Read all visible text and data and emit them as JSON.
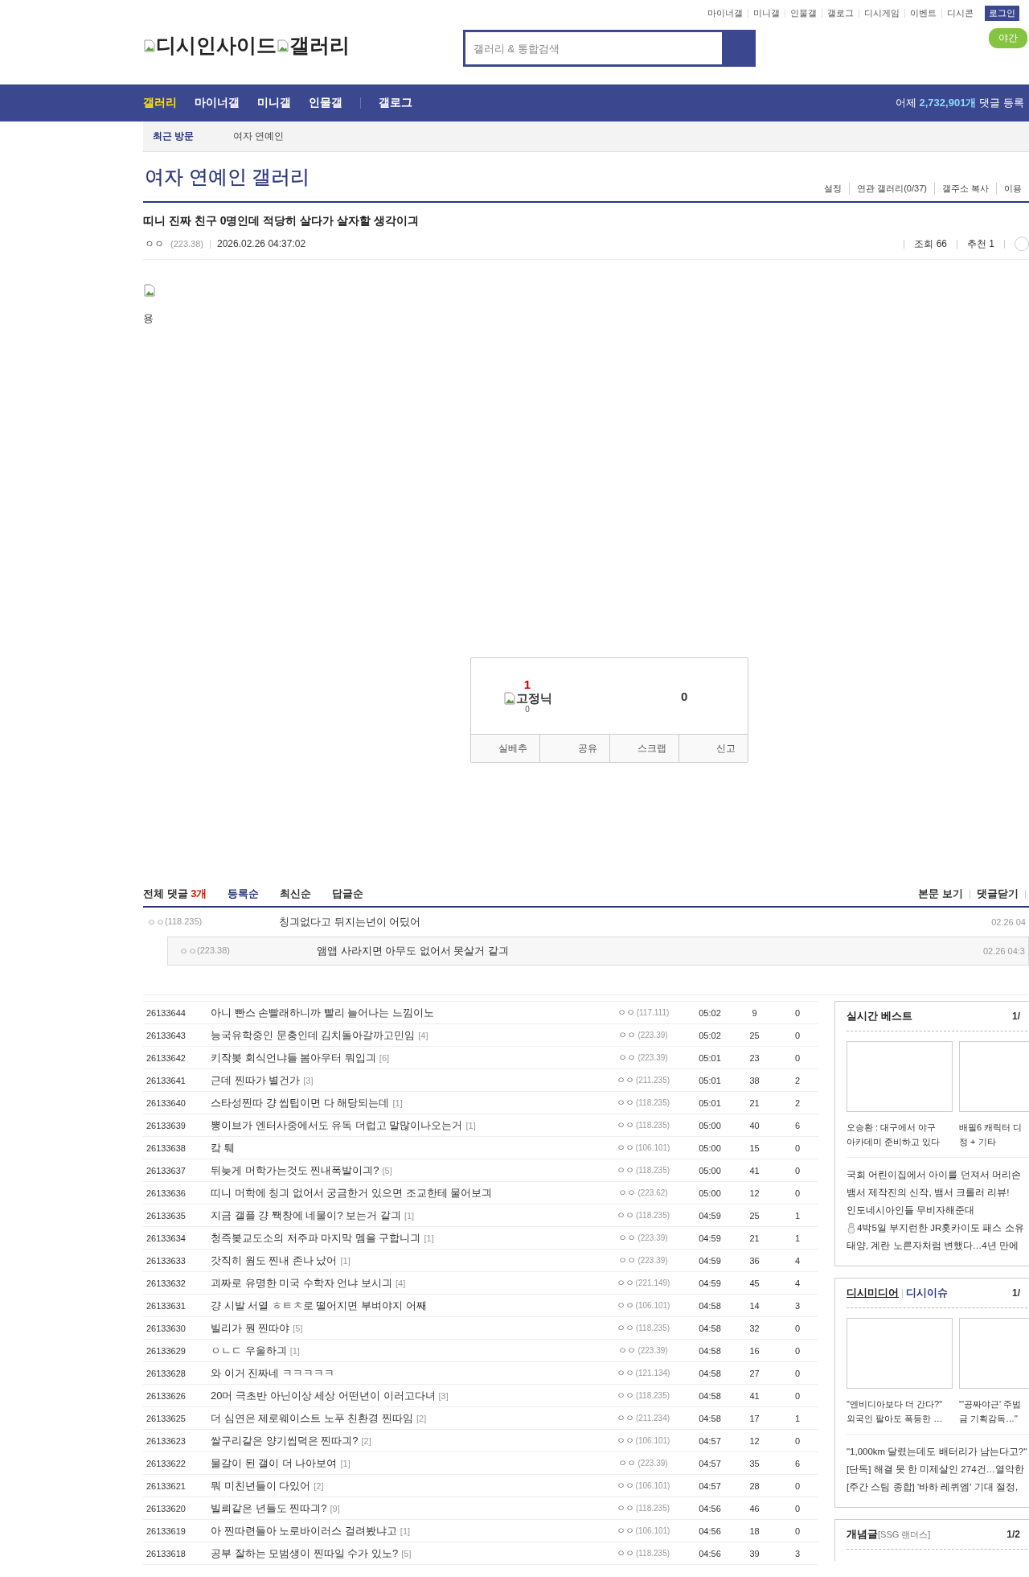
{
  "top_links": [
    "마이너갤",
    "미니갤",
    "인물갤",
    "갤로그",
    "디시게임",
    "이벤트",
    "디시콘"
  ],
  "login_button": "로그인",
  "night_mode_button": "야간",
  "logo": {
    "site": "디시인사이드",
    "section": "갤러리"
  },
  "search": {
    "placeholder": "갤러리 & 통합검색"
  },
  "nav": {
    "items": [
      {
        "label": "갤러리",
        "selected": true
      },
      {
        "label": "마이너갤",
        "selected": false
      },
      {
        "label": "미니갤",
        "selected": false
      },
      {
        "label": "인물갤",
        "selected": false
      },
      {
        "label": "갤로그",
        "selected": false
      }
    ],
    "stat_prefix": "어제",
    "stat_number": "2,732,901개",
    "stat_suffix": "댓글 등록"
  },
  "recent": {
    "label": "최근 방문",
    "items": [
      "여자 연예인"
    ]
  },
  "gallery": {
    "title": "여자 연예인 갤러리",
    "links": [
      "설정",
      "연관 갤러리(0/37)",
      "갤주소 복사",
      "이용"
    ]
  },
  "post": {
    "title": "띠니 진짜 친구 0명인데 적당히 살다가 살자할 생각이긔",
    "nick": "ㅇㅇ",
    "ip": "(223.38)",
    "date": "2026.02.26 04:37:02",
    "views": "조회 66",
    "recommend": "추천 1",
    "body_text": "용"
  },
  "vote": {
    "up": "1",
    "fixnick_label": "고정닉",
    "fixnick_count": "0",
    "down": "0",
    "buttons": [
      "실베추",
      "공유",
      "스크랩",
      "신고"
    ]
  },
  "comments": {
    "title": "전체 댓글",
    "count": "3개",
    "sorts": [
      {
        "label": "등록순",
        "selected": true
      },
      {
        "label": "최신순",
        "selected": false
      },
      {
        "label": "답글순",
        "selected": false
      }
    ],
    "actions": [
      "본문 보기",
      "댓글닫기"
    ],
    "items": [
      {
        "nick": "ㅇㅇ",
        "ip": "(118.235)",
        "text": "칭긔없다고 뒤지는년이 어딨어",
        "date": "02.26 04",
        "children": [
          {
            "nick": "ㅇㅇ",
            "ip": "(223.38)",
            "text": "앰앱 사라지면 아무도 없어서 못살거 같긔",
            "date": "02.26 04:3"
          }
        ]
      }
    ]
  },
  "list": [
    {
      "no": "26133644",
      "title": "아니 빤스 손빨래하니까 빨리 늘어나는 느낌이노",
      "nick": "ㅇㅇ",
      "ip": "(117.111)",
      "time": "05:02",
      "views": "9",
      "recommend": "0"
    },
    {
      "no": "26133643",
      "title": "능국유학중인 문충인데 김치돌아갈까고민임",
      "replies": "[4]",
      "nick": "ㅇㅇ",
      "ip": "(223.39)",
      "time": "05:02",
      "views": "25",
      "recommend": "0"
    },
    {
      "no": "26133642",
      "title": "키작봊 회식언냐들 봄아우터 뭐입긔",
      "replies": "[6]",
      "nick": "ㅇㅇ",
      "ip": "(223.39)",
      "time": "05:01",
      "views": "23",
      "recommend": "0"
    },
    {
      "no": "26133641",
      "title": "근데 찐따가 별건가",
      "replies": "[3]",
      "nick": "ㅇㅇ",
      "ip": "(211.235)",
      "time": "05:01",
      "views": "38",
      "recommend": "2"
    },
    {
      "no": "26133640",
      "title": "스타성찐따 걍 씹팁이면 다 해당되는데",
      "replies": "[1]",
      "nick": "ㅇㅇ",
      "ip": "(118.235)",
      "time": "05:01",
      "views": "21",
      "recommend": "2"
    },
    {
      "no": "26133639",
      "title": "뽕이브가 엔터사중에서도 유독 더럽고 말많이나오는거",
      "replies": "[1]",
      "nick": "ㅇㅇ",
      "ip": "(118.235)",
      "time": "05:00",
      "views": "40",
      "recommend": "6"
    },
    {
      "no": "26133638",
      "title": "캌 퉤",
      "nick": "ㅇㅇ",
      "ip": "(106.101)",
      "time": "05:00",
      "views": "15",
      "recommend": "0"
    },
    {
      "no": "26133637",
      "title": "뒤늦게 머학가는것도 찐내폭발이긔?",
      "replies": "[5]",
      "nick": "ㅇㅇ",
      "ip": "(118.235)",
      "time": "05:00",
      "views": "41",
      "recommend": "0"
    },
    {
      "no": "26133636",
      "title": "띠니 머학에 칭긔 없어서 궁금한거 있으면 조교한테 물어보긔",
      "nick": "ㅇㅇ",
      "ip": "(223.62)",
      "time": "05:00",
      "views": "12",
      "recommend": "0"
    },
    {
      "no": "26133635",
      "title": "지금 갤플 걍 짹창에 네물이? 보는거 같긔",
      "replies": "[1]",
      "nick": "ㅇㅇ",
      "ip": "(118.235)",
      "time": "04:59",
      "views": "25",
      "recommend": "1"
    },
    {
      "no": "26133634",
      "title": "청즉봊교도소의 저주파 마지막 멤을 구합니긔",
      "replies": "[1]",
      "nick": "ㅇㅇ",
      "ip": "(223.39)",
      "time": "04:59",
      "views": "21",
      "recommend": "1"
    },
    {
      "no": "26133633",
      "title": "갓직히 웜도 찐내 존나 났어",
      "replies": "[1]",
      "nick": "ㅇㅇ",
      "ip": "(223.39)",
      "time": "04:59",
      "views": "36",
      "recommend": "4"
    },
    {
      "no": "26133632",
      "title": "괴짜로 유명한 미국 수학자 언냐 보시긔",
      "replies": "[4]",
      "nick": "ㅇㅇ",
      "ip": "(221.149)",
      "time": "04:59",
      "views": "45",
      "recommend": "4"
    },
    {
      "no": "26133631",
      "title": "걍 시발 서열 ㅎㅌㅊ로 떨어지면 부벼야지 어째",
      "nick": "ㅇㅇ",
      "ip": "(106.101)",
      "time": "04:58",
      "views": "14",
      "recommend": "3"
    },
    {
      "no": "26133630",
      "title": "빌리가 뭔 찐따야",
      "replies": "[5]",
      "nick": "ㅇㅇ",
      "ip": "(118.235)",
      "time": "04:58",
      "views": "32",
      "recommend": "0"
    },
    {
      "no": "26133629",
      "title": "ㅇㄴㄷ 우울하긔",
      "replies": "[1]",
      "nick": "ㅇㅇ",
      "ip": "(223.39)",
      "time": "04:58",
      "views": "16",
      "recommend": "0"
    },
    {
      "no": "26133628",
      "title": "와 이거 진짜네 ㅋㅋㅋㅋㅋ",
      "nick": "ㅇㅇ",
      "ip": "(121.134)",
      "time": "04:58",
      "views": "27",
      "recommend": "0"
    },
    {
      "no": "26133626",
      "title": "20머 극초반 아닌이상 세상 어떤년이 이러고다녀",
      "replies": "[3]",
      "nick": "ㅇㅇ",
      "ip": "(118.235)",
      "time": "04:58",
      "views": "41",
      "recommend": "0"
    },
    {
      "no": "26133625",
      "title": "더 심연은 제로웨이스트 노푸 친환경 찐따임",
      "replies": "[2]",
      "nick": "ㅇㅇ",
      "ip": "(211.234)",
      "time": "04:58",
      "views": "17",
      "recommend": "1"
    },
    {
      "no": "26133623",
      "title": "쌀구리같은 양기씹덕은 찐따긔?",
      "replies": "[2]",
      "nick": "ㅇㅇ",
      "ip": "(106.101)",
      "time": "04:57",
      "views": "12",
      "recommend": "0"
    },
    {
      "no": "26133622",
      "title": "물갈이 된 갤이 더 나아보여",
      "replies": "[1]",
      "nick": "ㅇㅇ",
      "ip": "(223.39)",
      "time": "04:57",
      "views": "35",
      "recommend": "6"
    },
    {
      "no": "26133621",
      "title": "뭐 미친년들이 다있어",
      "replies": "[2]",
      "nick": "ㅇㅇ",
      "ip": "(106.101)",
      "time": "04:57",
      "views": "28",
      "recommend": "0"
    },
    {
      "no": "26133620",
      "title": "빌릐같은 년들도 찐따긔?",
      "replies": "[9]",
      "nick": "ㅇㅇ",
      "ip": "(118.235)",
      "time": "04:56",
      "views": "46",
      "recommend": "0"
    },
    {
      "no": "26133619",
      "title": "아 찐따련들아 노로바이러스 걸려봤냐고",
      "replies": "[1]",
      "nick": "ㅇㅇ",
      "ip": "(106.101)",
      "time": "04:56",
      "views": "18",
      "recommend": "0"
    },
    {
      "no": "26133618",
      "title": "공부 잘하는 모범생이 찐따일 수가 있노?",
      "replies": "[5]",
      "nick": "ㅇㅇ",
      "ip": "(118.235)",
      "time": "04:56",
      "views": "39",
      "recommend": "3"
    }
  ],
  "sidebar": {
    "best": {
      "title": "실시간 베스트",
      "page": "1/",
      "cards": [
        {
          "caption": [
            "오승환 : 대구에서 야구",
            "아카데미 준비하고 있다"
          ]
        },
        {
          "caption": [
            "배필6 캐릭터 디",
            "정 + 기타"
          ]
        }
      ],
      "links": [
        {
          "text": "국회 어린이집에서 아이를 던져서 머리손"
        },
        {
          "text": "뱀서 제작진의 신작, 뱀서 크롤러 리뷰!"
        },
        {
          "text": "인도네시아인들 무비자해준대"
        },
        {
          "text": "4박5일 부지런한 JR홋카이도 패스 소유",
          "icon": true
        },
        {
          "text": "태양, 계란 노른자처럼 변했다…4년 만에"
        }
      ]
    },
    "media": {
      "tabs": [
        {
          "label": "디시미디어",
          "selected": true
        },
        {
          "label": "디시이슈",
          "selected": false
        }
      ],
      "page": "1/",
      "cards": [
        {
          "caption": [
            "\"엔비디아보다 더 간다?\"",
            "외국인 팔아도 폭등한 …"
          ]
        },
        {
          "caption": [
            "\"'공짜야근' 주범",
            "금 기획감독…\""
          ]
        }
      ],
      "links": [
        {
          "text": "\"1,000km 달렸는데도 배터리가 남는다고?\""
        },
        {
          "text": "[단독] 해결 못 한 미제살인 274건…열악한"
        },
        {
          "text": "[주간 스팀 종합] '바하 레퀴엠' 기대 절정,"
        }
      ]
    },
    "concept": {
      "title": "개념글",
      "tag": "[SSG 랜더스]",
      "page": "1/2"
    }
  }
}
